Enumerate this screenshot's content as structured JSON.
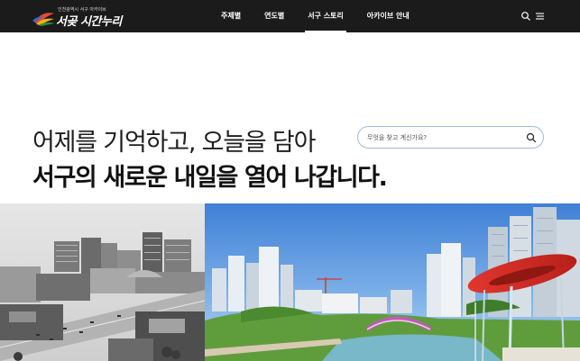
{
  "header": {
    "logo_sub": "인천광역시 서구 아카이브",
    "logo_main": "서곶 시간누리",
    "nav": [
      {
        "label": "주제별",
        "active": false
      },
      {
        "label": "연도별",
        "active": false
      },
      {
        "label": "서구 스토리",
        "active": true
      },
      {
        "label": "아카이브 안내",
        "active": false
      }
    ],
    "icons": {
      "search": "search-icon",
      "menu": "hamburger-menu-icon"
    }
  },
  "hero": {
    "line1": "어제를 기억하고, 오늘을 담아",
    "line2": "서구의 새로운 내일을 열어 나갑니다."
  },
  "search": {
    "placeholder": "무엇을 찾고 계신가요?",
    "value": ""
  },
  "colors": {
    "header_bg": "#1b1b1b",
    "search_border": "#9fbcd8",
    "text_dark": "#111111"
  }
}
